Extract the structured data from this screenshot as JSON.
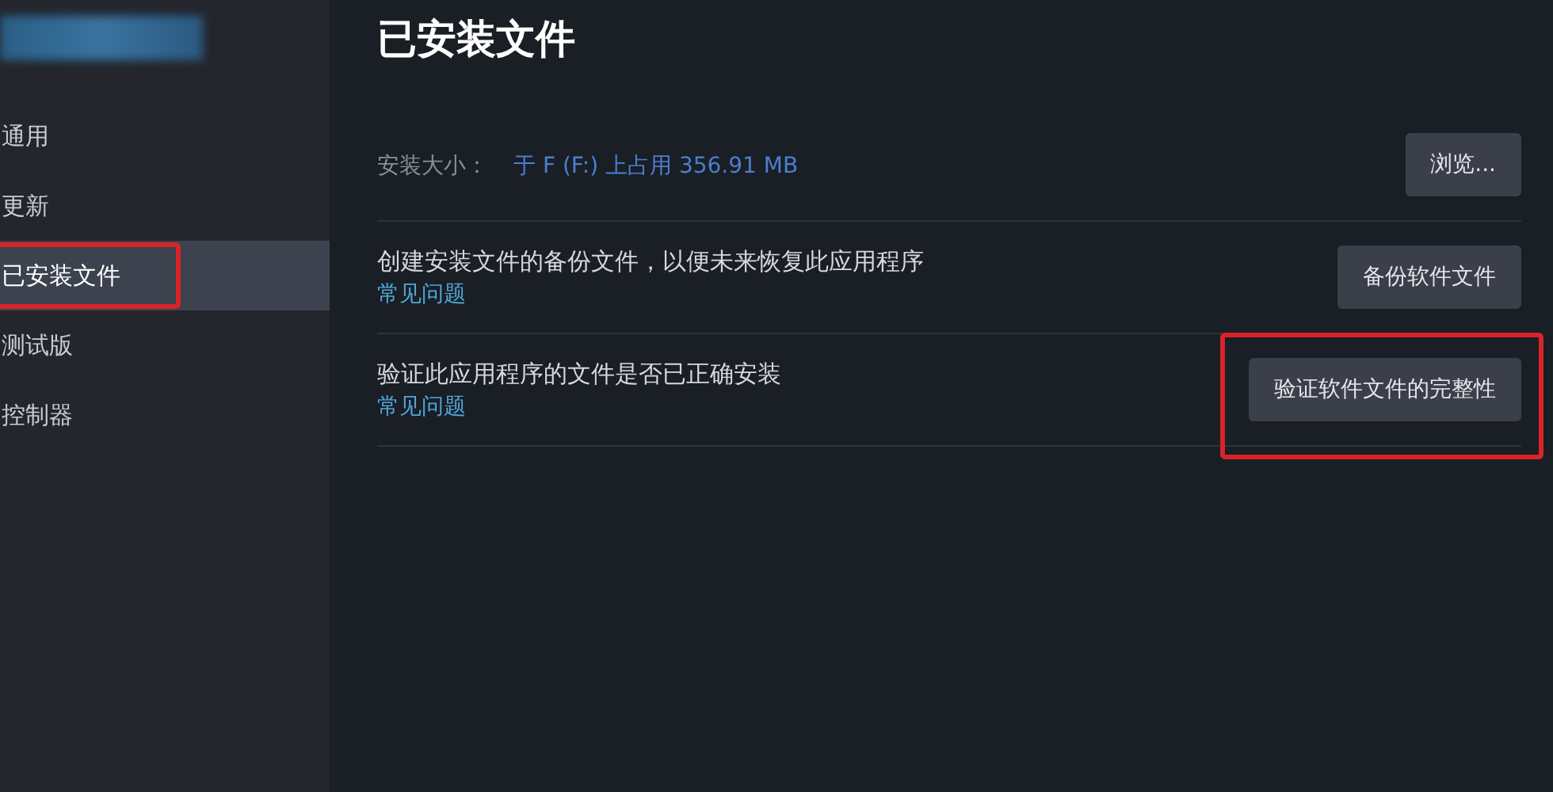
{
  "sidebar": {
    "items": [
      {
        "label": "通用",
        "selected": false,
        "highlighted": false
      },
      {
        "label": "更新",
        "selected": false,
        "highlighted": false
      },
      {
        "label": "已安装文件",
        "selected": true,
        "highlighted": true
      },
      {
        "label": "测试版",
        "selected": false,
        "highlighted": false
      },
      {
        "label": "控制器",
        "selected": false,
        "highlighted": false
      }
    ]
  },
  "main": {
    "title": "已安装文件",
    "size_row": {
      "label": "安装大小：",
      "value": "于 F (F:) 上占用 356.91 MB",
      "button": "浏览..."
    },
    "rows": [
      {
        "description": "创建安装文件的备份文件，以便未来恢复此应用程序",
        "link": "常见问题",
        "button": "备份软件文件",
        "highlighted": false
      },
      {
        "description": "验证此应用程序的文件是否已正确安装",
        "link": "常见问题",
        "button": "验证软件文件的完整性",
        "highlighted": true
      }
    ]
  }
}
